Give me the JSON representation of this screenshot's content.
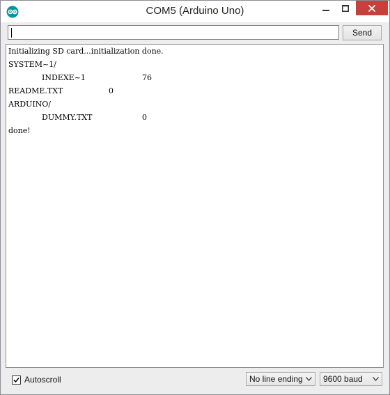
{
  "window": {
    "title": "COM5 (Arduino Uno)",
    "accent_close": "#c7413a",
    "icon": "arduino-logo-icon"
  },
  "input": {
    "value": "",
    "send_label": "Send"
  },
  "output": {
    "lines": [
      {
        "text": "Initializing SD card...initialization done.",
        "value": ""
      },
      {
        "text": "SYSTEM~1/",
        "value": ""
      },
      {
        "text": "\tINDEXE~1",
        "value": "76"
      },
      {
        "text": "README.TXT",
        "value": "0"
      },
      {
        "text": "ARDUINO/",
        "value": ""
      },
      {
        "text": "\tDUMMY.TXT",
        "value": "0"
      },
      {
        "text": "done!",
        "value": ""
      }
    ]
  },
  "footer": {
    "autoscroll_label": "Autoscroll",
    "autoscroll_checked": true,
    "line_ending": "No line ending",
    "baud": "9600 baud"
  }
}
